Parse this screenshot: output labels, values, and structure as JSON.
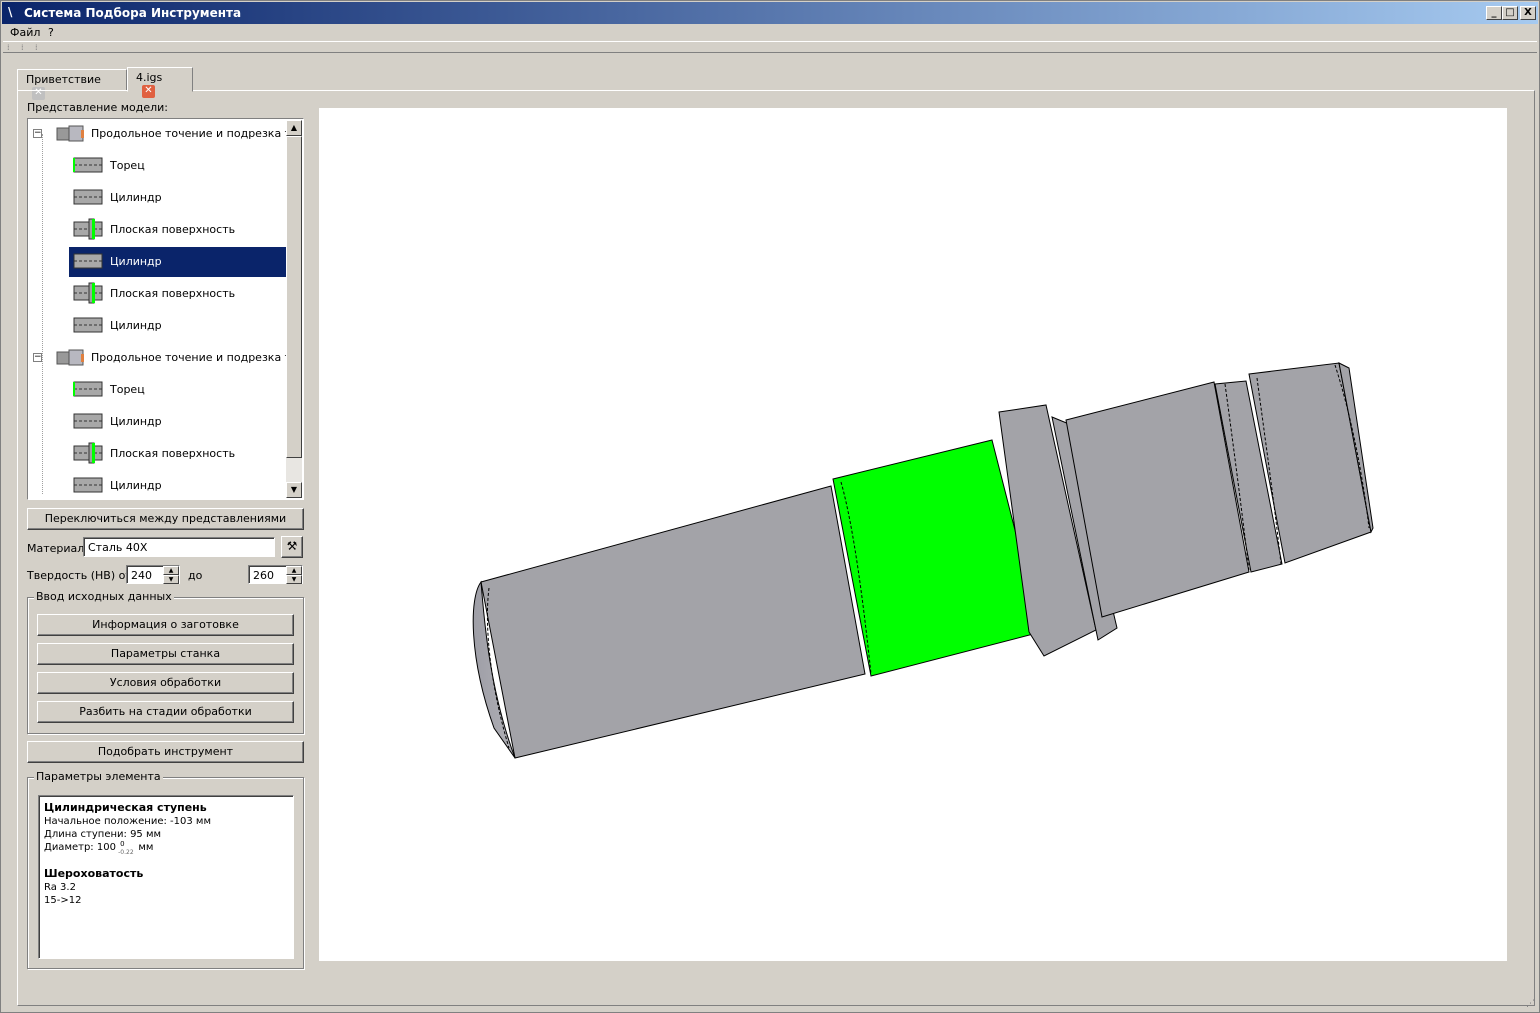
{
  "window": {
    "title": "Система Подбора Инструмента",
    "app_icon": "\\",
    "minimize": "_",
    "maximize": "□",
    "close": "X"
  },
  "menu": {
    "file": "Файл",
    "help": "?"
  },
  "tabs": [
    {
      "label": "Приветствие",
      "active": false
    },
    {
      "label": "4.igs",
      "active": true
    }
  ],
  "left_panel": {
    "tree_label": "Представление модели:",
    "tree": [
      {
        "kind": "group",
        "label": "Продольное точение и подрезка то..."
      },
      {
        "kind": "face",
        "label": "Торец"
      },
      {
        "kind": "cyl",
        "label": "Цилиндр"
      },
      {
        "kind": "flat",
        "label": "Плоская поверхность"
      },
      {
        "kind": "cyl",
        "label": "Цилиндр",
        "selected": true
      },
      {
        "kind": "flat",
        "label": "Плоская поверхность"
      },
      {
        "kind": "cyl",
        "label": "Цилиндр"
      },
      {
        "kind": "group",
        "label": "Продольное точение и подрезка то..."
      },
      {
        "kind": "face",
        "label": "Торец"
      },
      {
        "kind": "cyl",
        "label": "Цилиндр"
      },
      {
        "kind": "flat",
        "label": "Плоская поверхность"
      },
      {
        "kind": "cyl",
        "label": "Цилиндр"
      }
    ],
    "switch_button": "Переключиться между представлениями",
    "material_label": "Материал",
    "material_value": "Сталь 40Х",
    "hardness_label": "Твердость (HB) от",
    "hardness_from": "240",
    "hardness_to_label": "до",
    "hardness_to": "260",
    "input_group_title": "Ввод исходных данных",
    "input_buttons": [
      "Информация о заготовке",
      "Параметры станка",
      "Условия обработки",
      "Разбить на стадии обработки"
    ],
    "select_tool_button": "Подобрать инструмент",
    "params_group_title": "Параметры элемента",
    "params": {
      "heading": "Цилиндрическая ступень",
      "start_position": "Начальное положение: -103 мм",
      "step_length": "Длина ступени: 95 мм",
      "diameter_prefix": "Диаметр: 100",
      "diameter_upper": "0",
      "diameter_lower": "-0.22",
      "diameter_unit": "мм",
      "roughness_heading": "Шероховатость",
      "roughness_ra": "Ra 3.2",
      "roughness_grade": "15->12"
    }
  },
  "colors": {
    "selected_face": "#00ff00",
    "part_body": "#a3a3a8",
    "selection_bg": "#0a246a",
    "tab_close_active": "#e06040"
  }
}
